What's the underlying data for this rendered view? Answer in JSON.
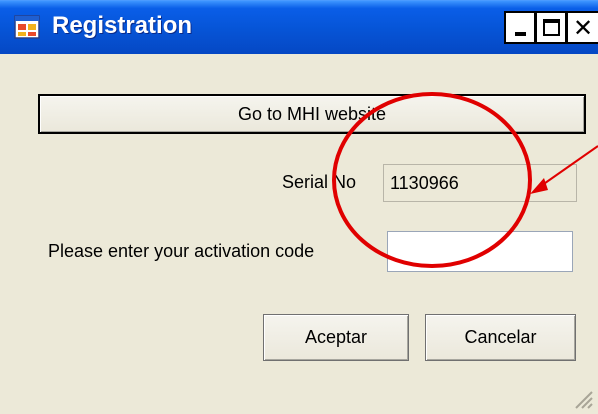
{
  "window": {
    "title": "Registration",
    "controls": {
      "minimize": "_",
      "maximize": "□",
      "close": "×"
    }
  },
  "form": {
    "website_button_label": "Go to MHI website",
    "serial_label": "Serial No",
    "serial_value": "1130966",
    "activation_label": "Please enter your activation code",
    "activation_value": "",
    "accept_label": "Aceptar",
    "cancel_label": "Cancelar"
  },
  "colors": {
    "titlebar": "#0654d6",
    "window_bg": "#ece9d8",
    "annotation": "#e00000"
  },
  "icons": {
    "app": "application-icon",
    "grip": "resize-grip-icon"
  }
}
